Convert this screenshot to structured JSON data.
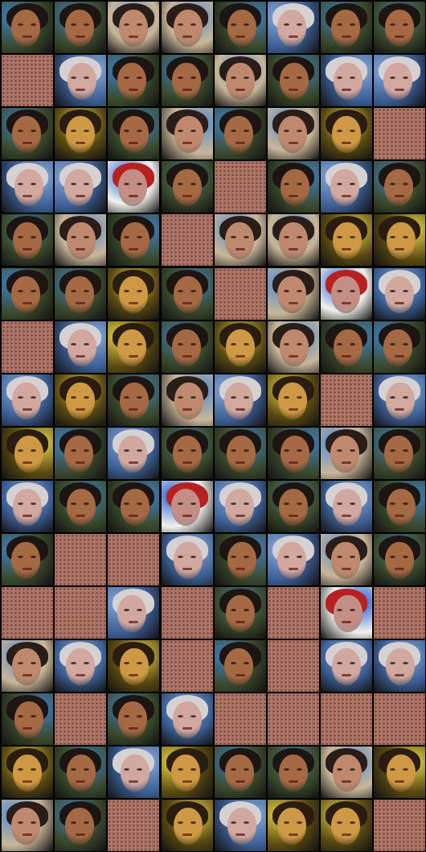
{
  "grid": {
    "rows": 16,
    "cols": 8,
    "tiles": [
      [
        "face-dark",
        "face-dark",
        "face-light",
        "face-light",
        "face-dark",
        "face-pale",
        "face-dark",
        "face-dark"
      ],
      [
        "pattern",
        "face-pale",
        "face-dark",
        "face-dark",
        "face-light",
        "face-dark",
        "face-pale",
        "face-pale"
      ],
      [
        "face-dark",
        "face-gold",
        "face-dark",
        "face-light",
        "face-dark",
        "face-light",
        "face-gold",
        "pattern"
      ],
      [
        "face-pale",
        "face-pale",
        "face-colorful",
        "face-dark",
        "pattern",
        "face-dark",
        "face-pale",
        "face-dark"
      ],
      [
        "face-dark",
        "face-light",
        "face-dark",
        "pattern",
        "face-light",
        "face-light",
        "face-gold",
        "face-gold"
      ],
      [
        "face-dark",
        "face-dark",
        "face-gold",
        "face-dark",
        "pattern",
        "face-light",
        "face-colorful",
        "face-pale"
      ],
      [
        "pattern",
        "face-pale",
        "face-gold",
        "face-dark",
        "face-gold",
        "face-light",
        "face-dark",
        "face-dark"
      ],
      [
        "face-pale",
        "face-gold",
        "face-dark",
        "face-light",
        "face-pale",
        "face-gold",
        "pattern",
        "face-pale"
      ],
      [
        "face-gold",
        "face-dark",
        "face-pale",
        "face-dark",
        "face-dark",
        "face-dark",
        "face-light",
        "face-dark"
      ],
      [
        "face-pale",
        "face-dark",
        "face-dark",
        "face-colorful",
        "face-pale",
        "face-dark",
        "face-pale",
        "face-dark"
      ],
      [
        "face-dark",
        "pattern",
        "pattern",
        "face-pale",
        "face-dark",
        "face-pale",
        "face-light",
        "face-dark"
      ],
      [
        "pattern",
        "pattern",
        "face-pale",
        "pattern",
        "face-dark",
        "pattern",
        "face-colorful",
        "pattern"
      ],
      [
        "face-light",
        "face-pale",
        "face-gold",
        "pattern",
        "face-dark",
        "pattern",
        "face-pale",
        "face-pale"
      ],
      [
        "face-dark",
        "pattern",
        "face-dark",
        "face-pale",
        "pattern",
        "pattern",
        "pattern",
        "pattern"
      ],
      [
        "face-gold",
        "face-dark",
        "face-pale",
        "face-gold",
        "face-dark",
        "face-dark",
        "face-light",
        "face-gold"
      ],
      [
        "face-light",
        "face-dark",
        "pattern",
        "face-gold",
        "face-pale",
        "face-gold",
        "face-gold",
        "pattern"
      ]
    ]
  },
  "palettes": {
    "face-dark": {
      "bg": "#3a4a2c",
      "hair": "#1c1512",
      "skin": "#a66a44",
      "accent": "#3f7fbf"
    },
    "face-light": {
      "bg": "#c9b79a",
      "hair": "#2a1d18",
      "skin": "#c08a6f",
      "accent": "#5b8fc9"
    },
    "face-pale": {
      "bg": "#3c5f95",
      "hair": "#d6d2d3",
      "skin": "#d2a9a0",
      "accent": "#86a8d6"
    },
    "face-gold": {
      "bg": "#5a4a12",
      "hair": "#2a1c10",
      "skin": "#cf9a45",
      "accent": "#e3d048"
    },
    "face-colorful": {
      "bg": "#f2f2ef",
      "hair": "#b92020",
      "skin": "#c48f86",
      "accent": "#2a5fd0"
    }
  }
}
